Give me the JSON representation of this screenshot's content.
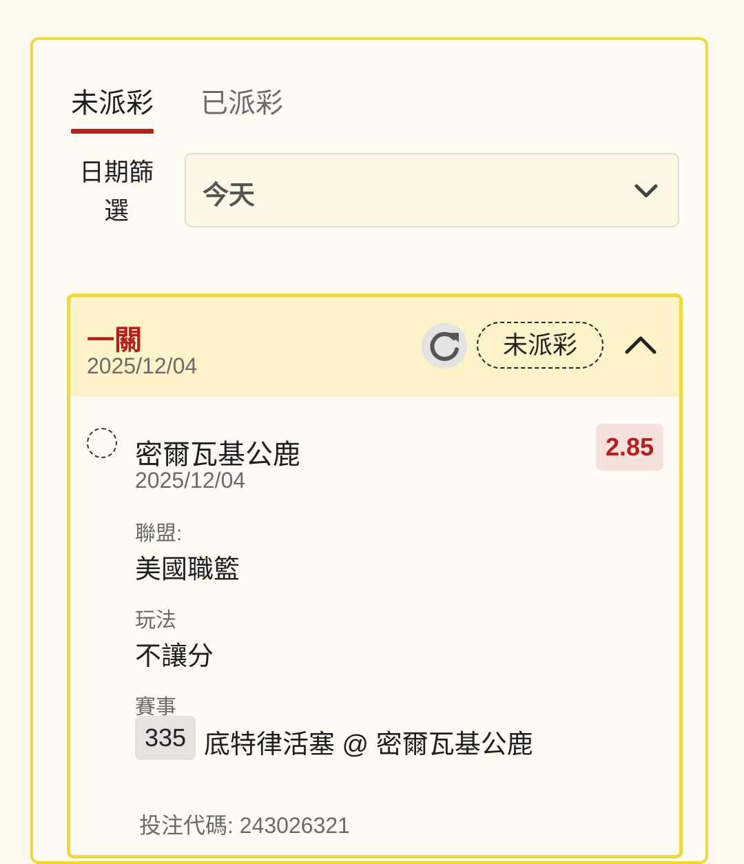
{
  "tabs": [
    {
      "label": "未派彩",
      "active": true
    },
    {
      "label": "已派彩",
      "active": false
    }
  ],
  "filter": {
    "label": "日期篩選",
    "selected": "今天"
  },
  "bet": {
    "type": "一關",
    "date": "2025/12/04",
    "status": "未派彩",
    "leg": {
      "team": "密爾瓦基公鹿",
      "date": "2025/12/04",
      "odds": "2.85",
      "league_label": "聯盟:",
      "league": "美國職籃",
      "play_label": "玩法",
      "play": "不讓分",
      "match_label": "賽事",
      "match_no": "335",
      "match_name": "底特律活塞 @ 密爾瓦基公鹿"
    },
    "ticket_label": "投注代碼: 243026321"
  },
  "colors": {
    "accent_red": "#b61f1c",
    "border_yellow": "#f2d73e",
    "header_yellow": "#fdf3c8"
  },
  "icons": [
    "chevron-down-icon",
    "refresh-icon",
    "chevron-up-icon",
    "radio-icon"
  ]
}
